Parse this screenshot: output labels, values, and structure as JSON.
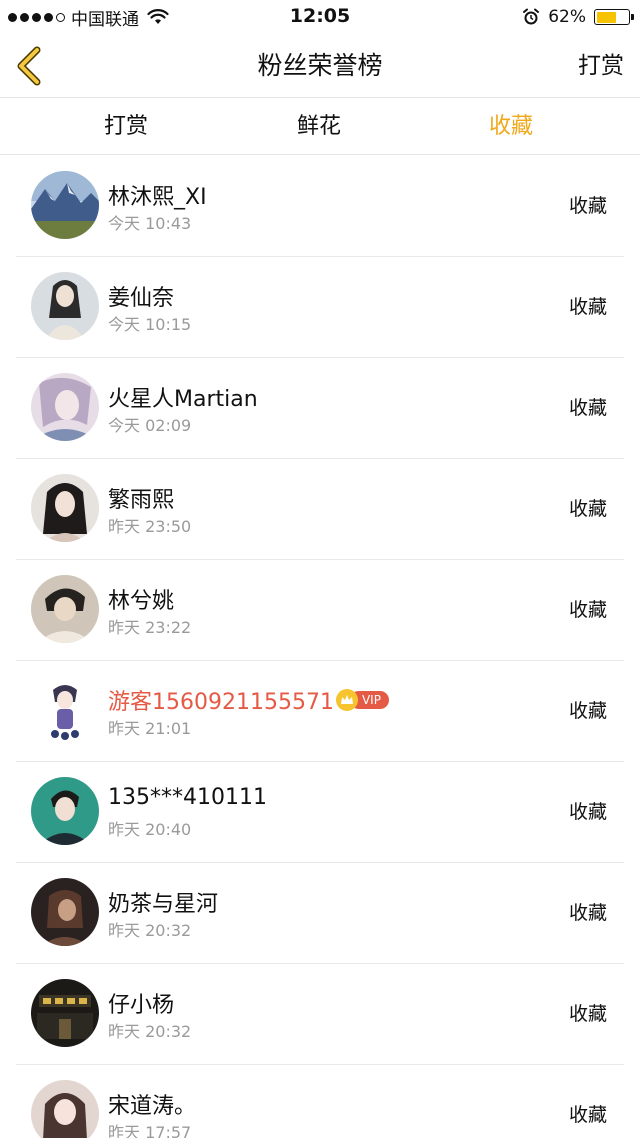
{
  "status_bar": {
    "carrier": "中国联通",
    "time": "12:05",
    "battery": "62%",
    "battery_level": 0.62
  },
  "nav": {
    "title": "粉丝荣誉榜",
    "right_action": "打赏",
    "back_icon": "chevron-left-icon"
  },
  "tabs": [
    {
      "label": "打赏",
      "active": false
    },
    {
      "label": "鲜花",
      "active": false
    },
    {
      "label": "收藏",
      "active": true
    }
  ],
  "colors": {
    "accent": "#f0a81c",
    "vip_name": "#e55a45",
    "secondary_text": "#9a9a9a"
  },
  "list": [
    {
      "name": "林沐熙_XI",
      "time": "今天 10:43",
      "action": "收藏"
    },
    {
      "name": "姜仙奈",
      "time": "今天 10:15",
      "action": "收藏"
    },
    {
      "name": "火星人Martian",
      "time": "今天 02:09",
      "action": "收藏"
    },
    {
      "name": "繁雨熙",
      "time": "昨天 23:50",
      "action": "收藏"
    },
    {
      "name": "林兮姚",
      "time": "昨天 23:22",
      "action": "收藏"
    },
    {
      "name": "游客1560921155571",
      "time": "昨天 21:01",
      "action": "收藏",
      "vip": "VIP"
    },
    {
      "name": "135***410111",
      "time": "昨天 20:40",
      "action": "收藏"
    },
    {
      "name": "奶茶与星河",
      "time": "昨天 20:32",
      "action": "收藏"
    },
    {
      "name": "仔小杨",
      "time": "昨天 20:32",
      "action": "收藏"
    },
    {
      "name": "宋道涛。",
      "time": "昨天 17:57",
      "action": "收藏"
    }
  ]
}
